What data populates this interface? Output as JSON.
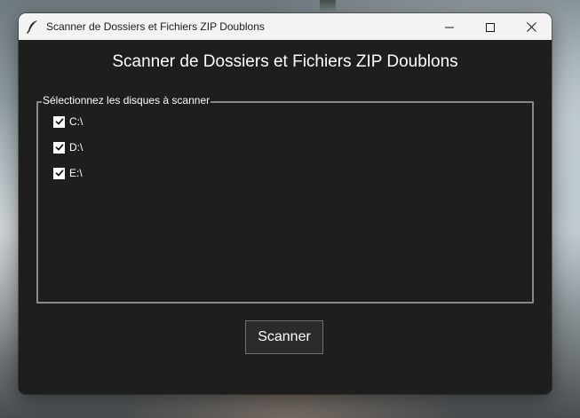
{
  "window": {
    "title": "Scanner de Dossiers et Fichiers ZIP Doublons",
    "icon": "feather-icon",
    "controls": {
      "minimize_icon": "minimize-icon",
      "maximize_icon": "maximize-icon",
      "close_icon": "close-icon"
    }
  },
  "main": {
    "heading": "Scanner de Dossiers et Fichiers ZIP Doublons",
    "drives_group": {
      "label": "Sélectionnez les disques à scanner",
      "drives": [
        {
          "label": "C:\\",
          "checked": true
        },
        {
          "label": "D:\\",
          "checked": true
        },
        {
          "label": "E:\\",
          "checked": true
        }
      ]
    },
    "scan_button_label": "Scanner"
  },
  "colors": {
    "window_bg": "#1e1e1e",
    "titlebar_bg": "#f3f3f3",
    "text": "#ffffff",
    "groupbox_border": "#8a8a8a",
    "button_bg": "#2b2b2b"
  }
}
